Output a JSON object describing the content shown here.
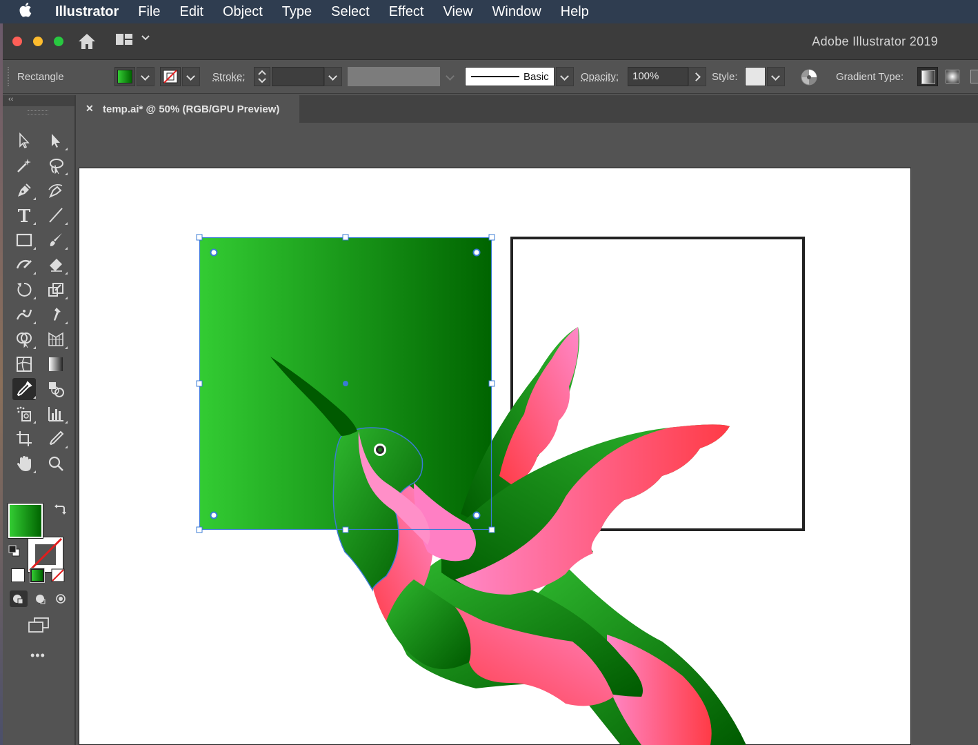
{
  "menubar": {
    "app_name": "Illustrator",
    "items": [
      "File",
      "Edit",
      "Object",
      "Type",
      "Select",
      "Effect",
      "View",
      "Window",
      "Help"
    ]
  },
  "window": {
    "title": "Adobe Illustrator 2019"
  },
  "control_bar": {
    "selection_type": "Rectangle",
    "stroke_label": "Stroke:",
    "stroke_value": "",
    "brush_definition": "Basic",
    "opacity_label": "Opacity:",
    "opacity_value": "100%",
    "style_label": "Style:",
    "gradient_type_label": "Gradient Type:"
  },
  "document_tab": {
    "close_glyph": "✕",
    "title": "temp.ai* @ 50% (RGB/GPU Preview)"
  },
  "tools": [
    "selection-tool",
    "direct-selection-tool",
    "magic-wand-tool",
    "lasso-tool",
    "pen-tool",
    "curvature-tool",
    "type-tool",
    "line-segment-tool",
    "rectangle-tool",
    "paintbrush-tool",
    "shaper-tool",
    "eraser-tool",
    "rotate-tool",
    "scale-tool",
    "width-tool",
    "puppet-warp-tool",
    "shape-builder-tool",
    "perspective-grid-tool",
    "mesh-tool",
    "gradient-tool",
    "eyedropper-tool",
    "blend-tool",
    "symbol-sprayer-tool",
    "column-graph-tool",
    "artboard-tool",
    "slice-tool",
    "hand-tool",
    "zoom-tool"
  ],
  "colors": {
    "menubar_bg": "#2f3d50",
    "fill_gradient_start": "#33cc33",
    "fill_gradient_end": "#006400",
    "selection_blue": "#3a7bd5",
    "bird_pink": "#ff88c8",
    "bird_red": "#ff3b46",
    "bird_green_dark": "#005a00"
  },
  "more_tools_glyph": "•••"
}
